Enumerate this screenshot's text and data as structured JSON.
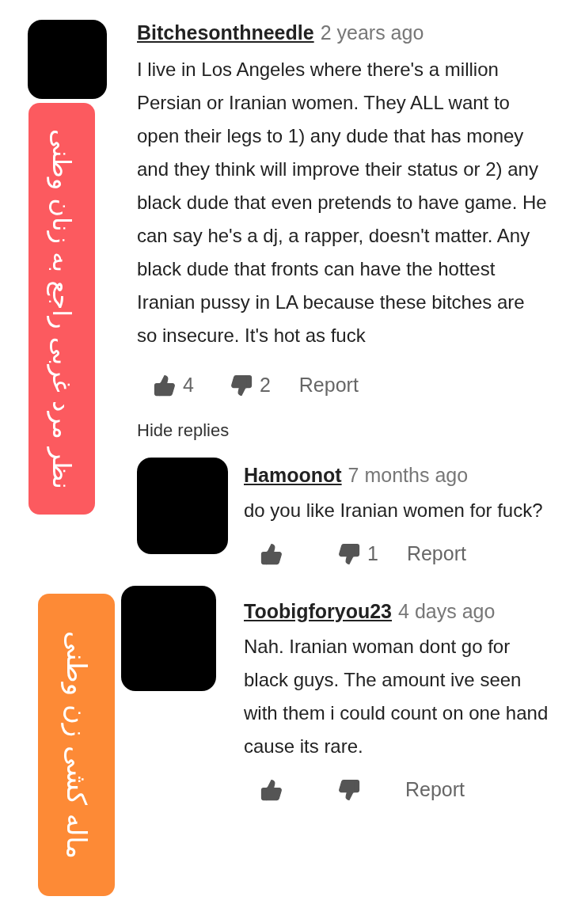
{
  "comments": [
    {
      "username": "Bitchesonthneedle",
      "time": "2 years ago",
      "text": "I live in Los Angeles where there's a million Persian or Iranian women. They ALL want to open their legs to 1) any dude that has money and they think will improve their status or 2) any black dude that even pretends to have game. He can say he's a dj, a rapper, doesn't matter. Any black dude that fronts can have the hottest Iranian pussy in LA because these bitches are so insecure. It's hot as fuck",
      "likes": "4",
      "dislikes": "2",
      "report": "Report",
      "hide_replies": "Hide replies",
      "replies": [
        {
          "username": "Hamoonot",
          "time": "7 months ago",
          "text": "do you like Iranian women for fuck?",
          "dislikes": "1",
          "report": "Report"
        },
        {
          "username": "Toobigforyou23",
          "time": "4 days ago",
          "text": "Nah. Iranian woman dont go for black guys. The amount ive seen with them i could count on one hand cause its rare.",
          "report": "Report"
        }
      ]
    }
  ],
  "annotations": [
    {
      "text": "نظر مرد غربی راجع به زنان وطنی",
      "color": "#fc5a5f"
    },
    {
      "text": "ماله کشی زن وطنی",
      "color": "#fd8a36"
    }
  ]
}
